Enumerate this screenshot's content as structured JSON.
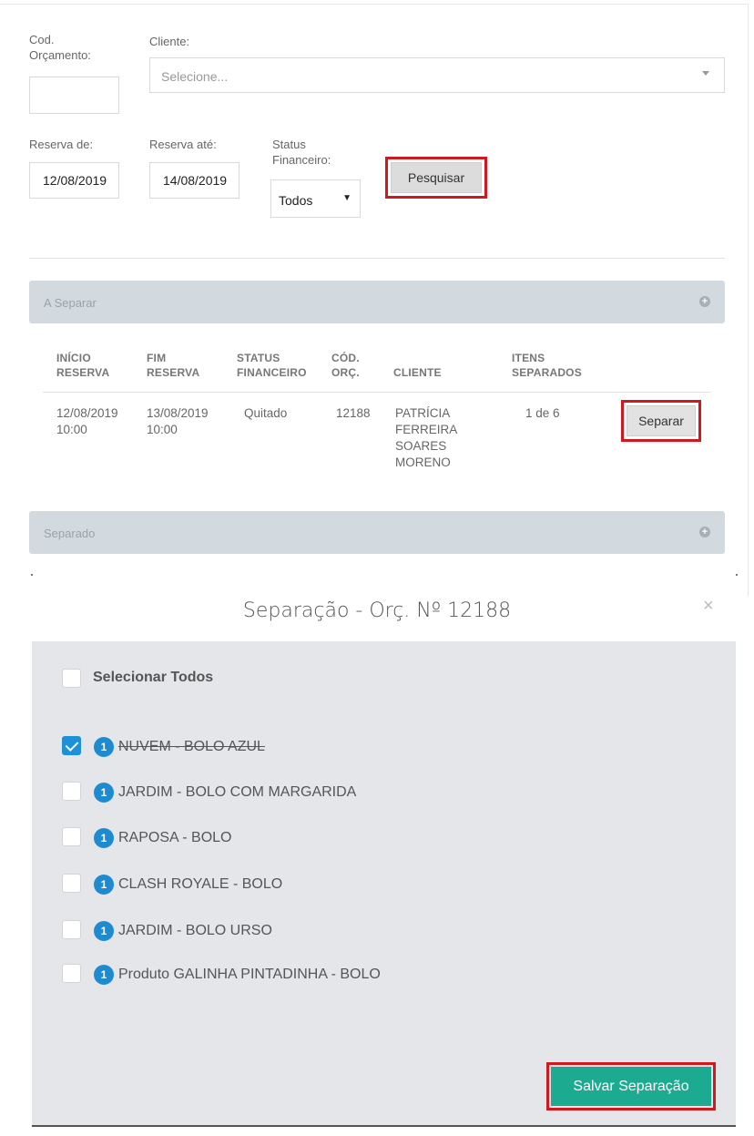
{
  "filters": {
    "cod_orcamento_label_1": "Cod.",
    "cod_orcamento_label_2": "Orçamento:",
    "cod_orcamento_value": "",
    "cliente_label": "Cliente:",
    "cliente_placeholder": "Selecione...",
    "reserva_de_label": "Reserva de:",
    "reserva_de_value": "12/08/2019",
    "reserva_ate_label": "Reserva até:",
    "reserva_ate_value": "14/08/2019",
    "status_label_1": "Status",
    "status_label_2": "Financeiro:",
    "status_value": "Todos",
    "pesquisar_label": "Pesquisar"
  },
  "panels": {
    "a_separar": "A Separar",
    "separado": "Separado",
    "expand_symbol": "+"
  },
  "table": {
    "headers": {
      "inicio_1": "INÍCIO",
      "inicio_2": "RESERVA",
      "fim_1": "FIM",
      "fim_2": "RESERVA",
      "status_1": "STATUS",
      "status_2": "FINANCEIRO",
      "cod_1": "CÓD.",
      "cod_2": "ORÇ.",
      "cliente": "CLIENTE",
      "itens_1": "ITENS",
      "itens_2": "SEPARADOS"
    },
    "row": {
      "inicio_date": "12/08/2019",
      "inicio_time": "10:00",
      "fim_date": "13/08/2019",
      "fim_time": "10:00",
      "status": "Quitado",
      "cod": "12188",
      "cliente_1": "PATRÍCIA",
      "cliente_2": "FERREIRA",
      "cliente_3": "SOARES",
      "cliente_4": "MORENO",
      "itens": "1 de 6",
      "action": "Separar"
    }
  },
  "modal": {
    "title": "Separação - Orç. Nº 12188",
    "close": "×",
    "select_all": "Selecionar Todos",
    "items": [
      {
        "qty": "1",
        "name": "NUVEM - BOLO AZUL",
        "checked": true
      },
      {
        "qty": "1",
        "name": "JARDIM - BOLO COM MARGARIDA",
        "checked": false
      },
      {
        "qty": "1",
        "name": "RAPOSA - BOLO",
        "checked": false
      },
      {
        "qty": "1",
        "name": "CLASH ROYALE - BOLO",
        "checked": false
      },
      {
        "qty": "1",
        "name": "JARDIM - BOLO URSO",
        "checked": false
      },
      {
        "qty": "1",
        "name": "Produto GALINHA PINTADINHA - BOLO",
        "checked": false
      }
    ],
    "save_label": "Salvar Separação"
  },
  "colors": {
    "accent_teal": "#1cab91",
    "badge_blue": "#1e8bd0",
    "highlight_red": "#d0191f",
    "panel_gray": "#d3dadf"
  }
}
